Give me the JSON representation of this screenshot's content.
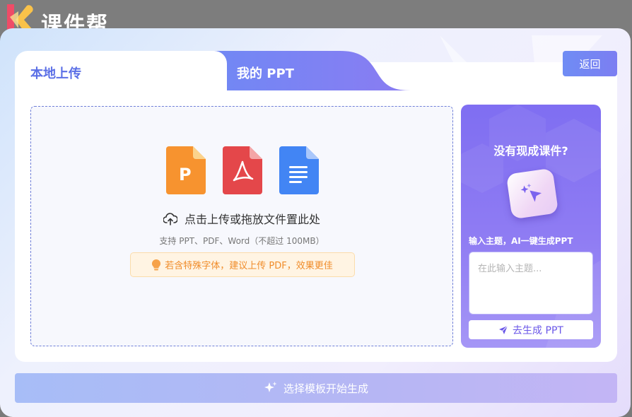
{
  "app": {
    "name": "课件帮"
  },
  "tabs": [
    {
      "label": "本地上传",
      "active": true
    },
    {
      "label": "我的 PPT",
      "active": false
    }
  ],
  "header": {
    "back_label": "返回"
  },
  "upload": {
    "file_icons": [
      "ppt-file-icon",
      "pdf-file-icon",
      "word-file-icon"
    ],
    "prompt": "点击上传或拖放文件置此处",
    "support": "支持 PPT、PDF、Word（不超过 100MB）",
    "tip": "若含特殊字体，建议上传 PDF，效果更佳"
  },
  "ai_panel": {
    "title": "没有现成课件?",
    "hint": "输入主题，AI一键生成PPT",
    "input_placeholder": "在此输入主题...",
    "input_value": "",
    "generate_label": "去生成 PPT"
  },
  "footer": {
    "start_label": "选择模板开始生成"
  },
  "colors": {
    "accent": "#5b6fe6",
    "tab_active_text": "#5b6fe6",
    "ai_card": "#8371f2",
    "tip_text": "#f08c2a",
    "ppt_icon": "#f7932f",
    "pdf_icon": "#e4474a",
    "word_icon": "#4285f4"
  }
}
